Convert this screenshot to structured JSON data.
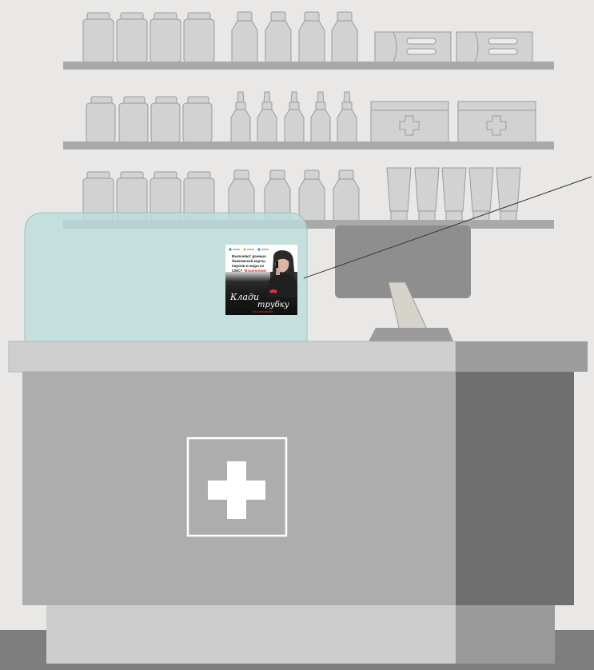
{
  "colors": {
    "wall": "#e9e8e6",
    "floor": "#7e7e7e",
    "shelf": "#a9a9a9",
    "item": "#d2d2d2",
    "item_stroke": "#9a9a9a",
    "counter_top": "#cfcfcf",
    "counter_front": "#adadad",
    "counter_side": "#6f6f6f",
    "counter_base": "#cdcdcd",
    "glass": "#b9dcdc",
    "monitor": "#8e8e8e",
    "accent_red": "#e0312d",
    "cross": "#ffffff"
  },
  "icons": {
    "counter_emblem": "medical-cross-icon",
    "box_emblem": "medical-cross-icon",
    "poster_logos": "partner-logo-icon",
    "poster_phone": "phone-handset-icon"
  },
  "poster": {
    "headline": [
      "Выясняют данные",
      "банковской карты,",
      "пароли и коды из",
      "СМС?"
    ],
    "headline_accent": "Мошенники!",
    "brand_line1": "Клади",
    "brand_line2": "трубку",
    "footer": "Без разговоров"
  }
}
